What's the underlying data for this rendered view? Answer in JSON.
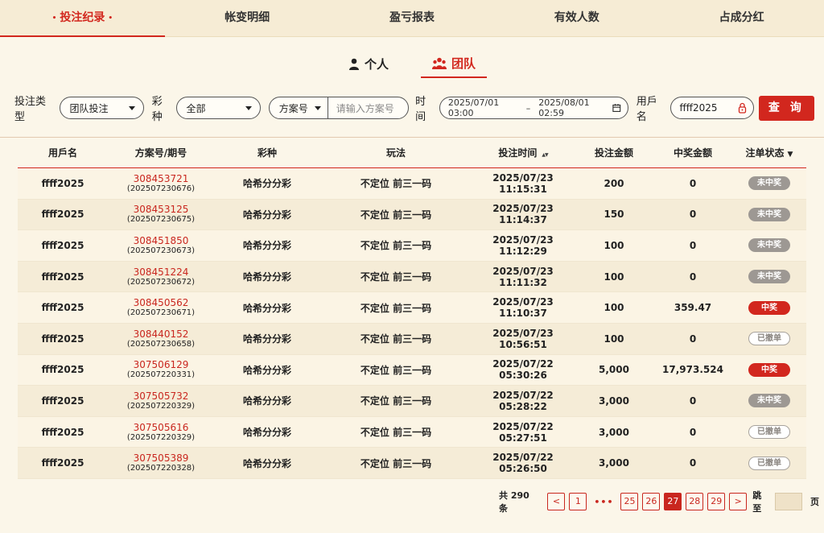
{
  "tabs": [
    {
      "label": "投注纪录",
      "active": true
    },
    {
      "label": "帐变明细",
      "active": false
    },
    {
      "label": "盈亏报表",
      "active": false
    },
    {
      "label": "有效人数",
      "active": false
    },
    {
      "label": "占成分红",
      "active": false
    }
  ],
  "subtabs": {
    "personal": "个人",
    "team": "团队",
    "active": "team"
  },
  "filters": {
    "bet_type_label": "投注类型",
    "bet_type_value": "团队投注",
    "lottery_label": "彩种",
    "lottery_value": "全部",
    "plan_type": "方案号",
    "plan_placeholder": "请输入方案号",
    "time_label": "时间",
    "start_time": "2025/07/01 03:00",
    "range_sep": "–",
    "end_time": "2025/08/01 02:59",
    "username_label": "用戶名",
    "username_value": "ffff2025",
    "query_button": "查 询"
  },
  "table": {
    "headers": [
      "用戶名",
      "方案号/期号",
      "彩种",
      "玩法",
      "投注时间",
      "投注金额",
      "中奖金额",
      "注单状态"
    ],
    "rows": [
      {
        "user": "ffff2025",
        "plan": "308453721",
        "issue": "(202507230676)",
        "lottery": "哈希分分彩",
        "play": "不定位 前三一码",
        "time": "2025/07/23 11:15:31",
        "bet": "200",
        "win": "0",
        "status": "未中奖",
        "status_type": "lose"
      },
      {
        "user": "ffff2025",
        "plan": "308453125",
        "issue": "(202507230675)",
        "lottery": "哈希分分彩",
        "play": "不定位 前三一码",
        "time": "2025/07/23 11:14:37",
        "bet": "150",
        "win": "0",
        "status": "未中奖",
        "status_type": "lose"
      },
      {
        "user": "ffff2025",
        "plan": "308451850",
        "issue": "(202507230673)",
        "lottery": "哈希分分彩",
        "play": "不定位 前三一码",
        "time": "2025/07/23 11:12:29",
        "bet": "100",
        "win": "0",
        "status": "未中奖",
        "status_type": "lose"
      },
      {
        "user": "ffff2025",
        "plan": "308451224",
        "issue": "(202507230672)",
        "lottery": "哈希分分彩",
        "play": "不定位 前三一码",
        "time": "2025/07/23 11:11:32",
        "bet": "100",
        "win": "0",
        "status": "未中奖",
        "status_type": "lose"
      },
      {
        "user": "ffff2025",
        "plan": "308450562",
        "issue": "(202507230671)",
        "lottery": "哈希分分彩",
        "play": "不定位 前三一码",
        "time": "2025/07/23 11:10:37",
        "bet": "100",
        "win": "359.47",
        "status": "中奖",
        "status_type": "win"
      },
      {
        "user": "ffff2025",
        "plan": "308440152",
        "issue": "(202507230658)",
        "lottery": "哈希分分彩",
        "play": "不定位 前三一码",
        "time": "2025/07/23 10:56:51",
        "bet": "100",
        "win": "0",
        "status": "已撤单",
        "status_type": "cancel"
      },
      {
        "user": "ffff2025",
        "plan": "307506129",
        "issue": "(202507220331)",
        "lottery": "哈希分分彩",
        "play": "不定位 前三一码",
        "time": "2025/07/22 05:30:26",
        "bet": "5,000",
        "win": "17,973.524",
        "status": "中奖",
        "status_type": "win"
      },
      {
        "user": "ffff2025",
        "plan": "307505732",
        "issue": "(202507220329)",
        "lottery": "哈希分分彩",
        "play": "不定位 前三一码",
        "time": "2025/07/22 05:28:22",
        "bet": "3,000",
        "win": "0",
        "status": "未中奖",
        "status_type": "lose"
      },
      {
        "user": "ffff2025",
        "plan": "307505616",
        "issue": "(202507220329)",
        "lottery": "哈希分分彩",
        "play": "不定位 前三一码",
        "time": "2025/07/22 05:27:51",
        "bet": "3,000",
        "win": "0",
        "status": "已撤单",
        "status_type": "cancel"
      },
      {
        "user": "ffff2025",
        "plan": "307505389",
        "issue": "(202507220328)",
        "lottery": "哈希分分彩",
        "play": "不定位 前三一码",
        "time": "2025/07/22 05:26:50",
        "bet": "3,000",
        "win": "0",
        "status": "已撤单",
        "status_type": "cancel"
      }
    ]
  },
  "pagination": {
    "total": "共 290 条",
    "prev": "<",
    "first": "1",
    "ellipsis": "•••",
    "pages": [
      "25",
      "26",
      "27",
      "28",
      "29"
    ],
    "current": "27",
    "next": ">",
    "jump_label": "跳至",
    "page_suffix": "页"
  },
  "colors": {
    "accent": "#d2271e",
    "background": "#fbf6e9",
    "lose_badge": "#9d9893"
  }
}
